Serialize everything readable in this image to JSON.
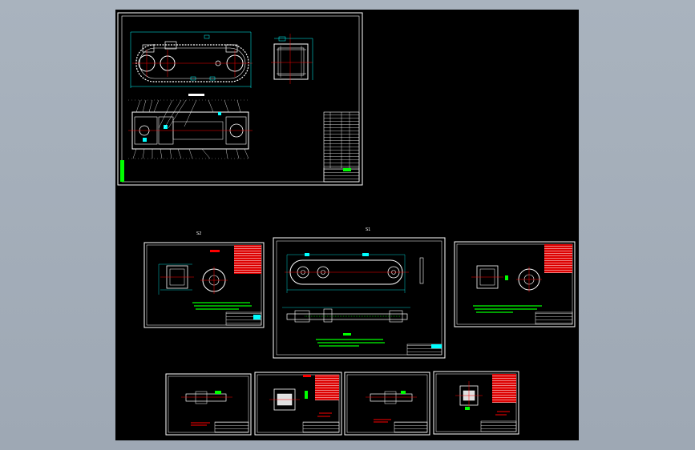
{
  "window": {
    "title": "",
    "background": "#a6b0bc"
  },
  "model_space": {
    "background": "#000000"
  },
  "colors": {
    "frame": "#ffffff",
    "geometry": "#00ff00",
    "dimension": "#00ffff",
    "centerline": "#ff0000",
    "titleblock_fill": "#ff0000"
  },
  "sheet_labels": {
    "s1": "S1",
    "s2": "S2"
  },
  "drawings": [
    {
      "id": "assembly",
      "type": "general-assembly"
    },
    {
      "id": "s2",
      "type": "part-wheel"
    },
    {
      "id": "s1",
      "type": "part-frame"
    },
    {
      "id": "s3",
      "type": "part-wheel"
    },
    {
      "id": "d4",
      "type": "part-shaft"
    },
    {
      "id": "d5",
      "type": "part-hub"
    },
    {
      "id": "d6",
      "type": "part-shaft"
    },
    {
      "id": "d7",
      "type": "part-hub"
    }
  ]
}
